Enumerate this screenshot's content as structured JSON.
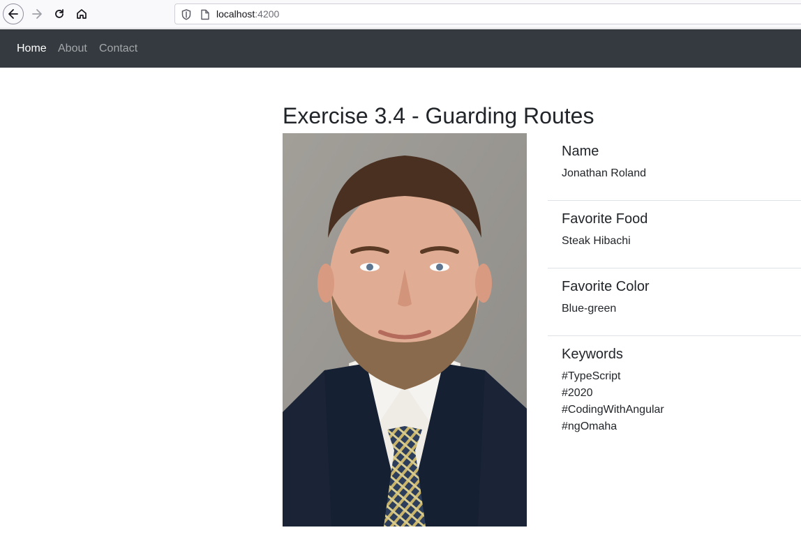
{
  "browser": {
    "url_host": "localhost",
    "url_port": ":4200"
  },
  "navbar": {
    "links": [
      {
        "label": "Home"
      },
      {
        "label": "About"
      },
      {
        "label": "Contact"
      }
    ]
  },
  "page": {
    "title": "Exercise 3.4 - Guarding Routes"
  },
  "details": {
    "name": {
      "heading": "Name",
      "value": "Jonathan Roland"
    },
    "food": {
      "heading": "Favorite Food",
      "value": "Steak Hibachi"
    },
    "color": {
      "heading": "Favorite Color",
      "value": "Blue-green"
    },
    "keywords": {
      "heading": "Keywords",
      "items": [
        "#TypeScript",
        "#2020",
        "#CodingWithAngular",
        "#ngOmaha"
      ]
    }
  }
}
